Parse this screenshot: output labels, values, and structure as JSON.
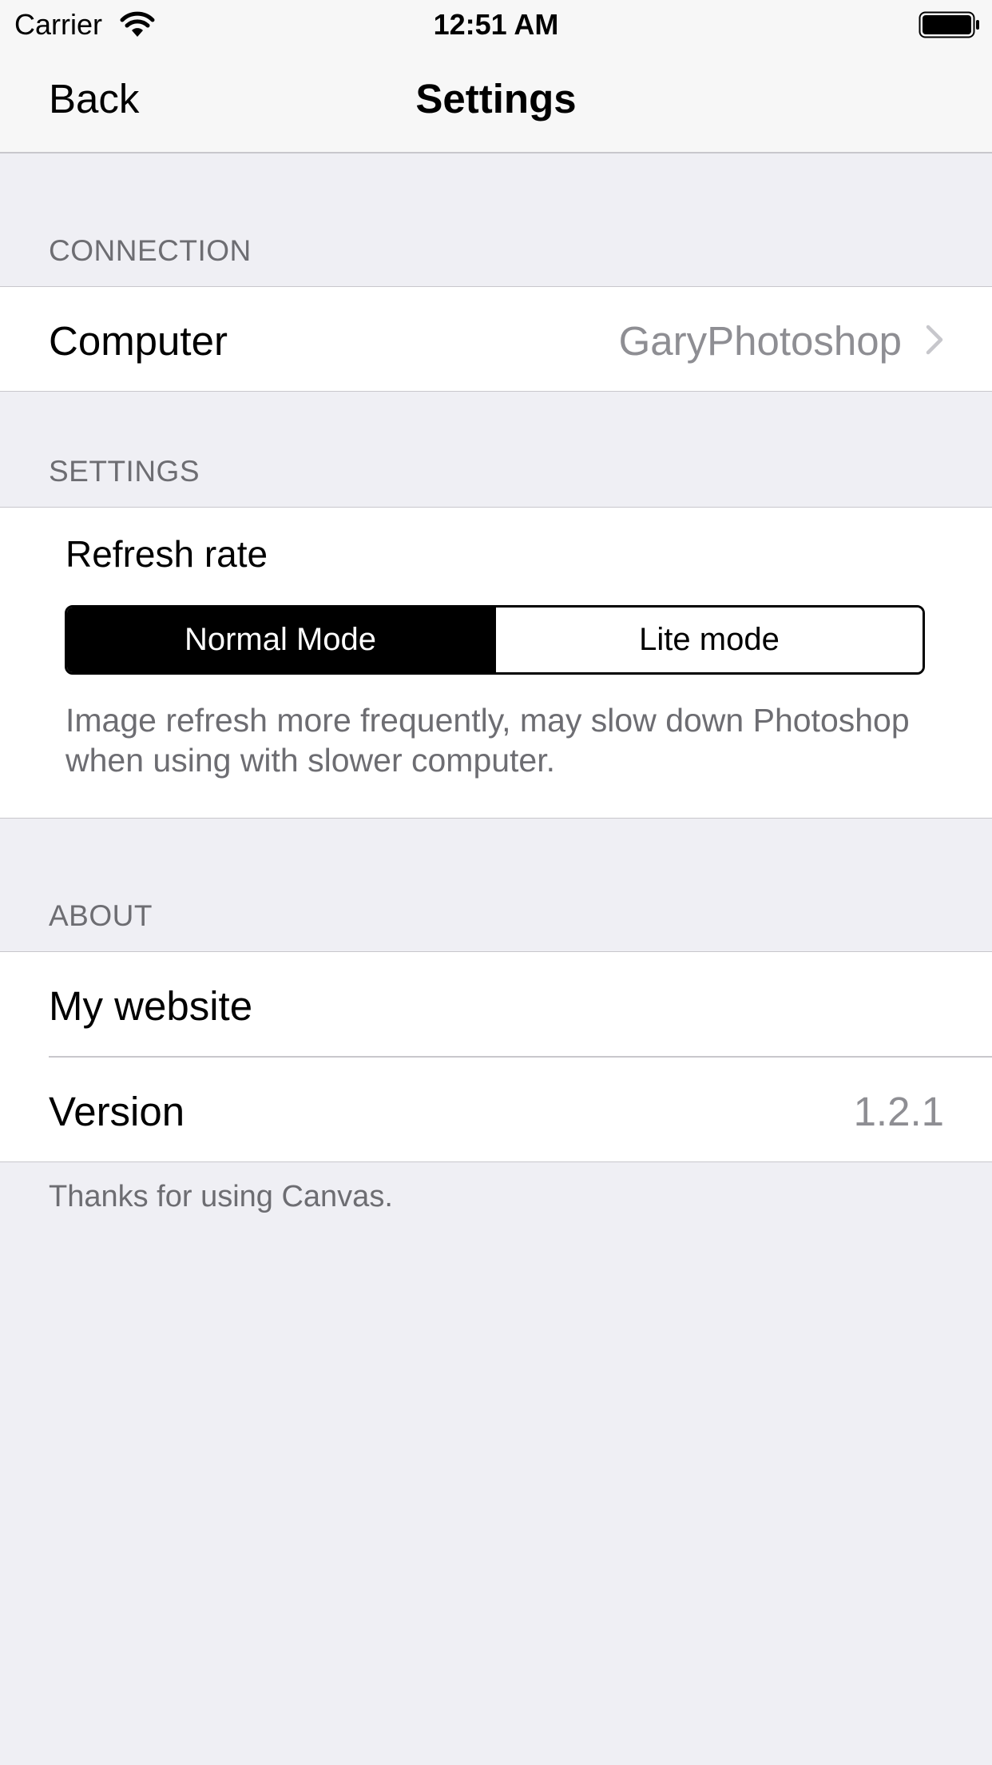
{
  "status_bar": {
    "carrier": "Carrier",
    "time": "12:51 AM"
  },
  "nav": {
    "back_label": "Back",
    "title": "Settings"
  },
  "sections": {
    "connection": {
      "header": "CONNECTION",
      "computer_label": "Computer",
      "computer_value": "GaryPhotoshop"
    },
    "settings": {
      "header": "SETTINGS",
      "refresh_label": "Refresh rate",
      "segments": [
        "Normal Mode",
        "Lite mode"
      ],
      "selected_segment": "Normal Mode",
      "description": "Image refresh more frequently, may slow down Photoshop when using with slower computer."
    },
    "about": {
      "header": "ABOUT",
      "website_label": "My website",
      "version_label": "Version",
      "version_value": "1.2.1",
      "footer": "Thanks for using Canvas."
    }
  },
  "icons": {
    "wifi": "wifi-icon",
    "battery": "battery-icon",
    "chevron": "chevron-right-icon"
  },
  "colors": {
    "background": "#efeff4",
    "secondary_text": "#6d6d72",
    "value_text": "#8e8e93",
    "separator": "#c8c7cc",
    "segment_tint": "#000000"
  }
}
